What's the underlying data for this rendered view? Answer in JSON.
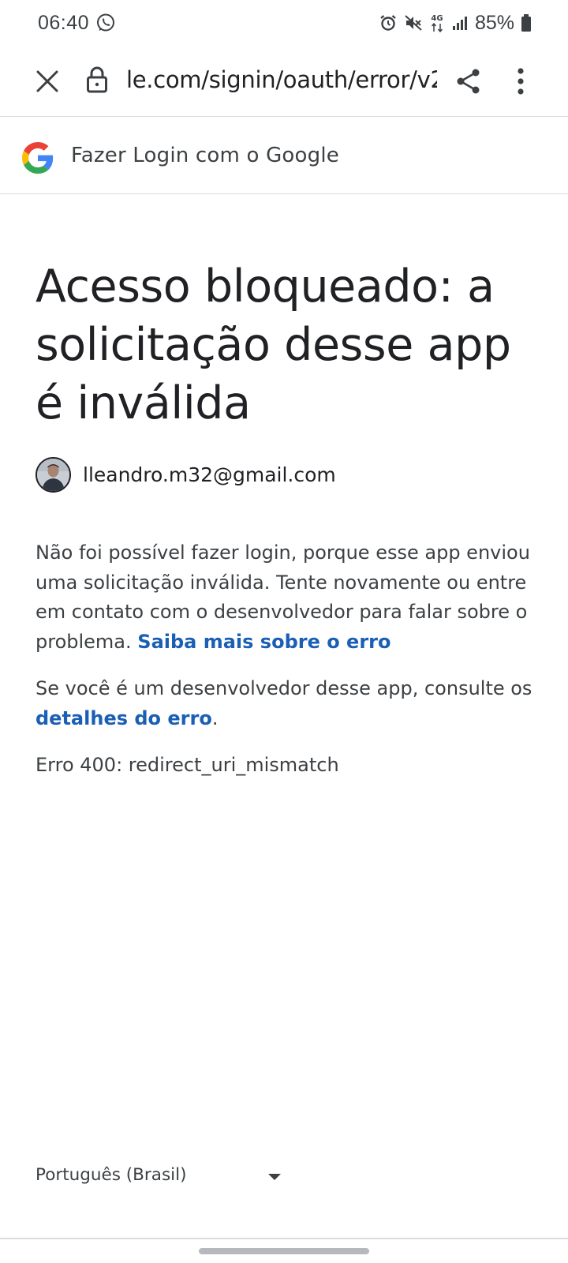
{
  "status_bar": {
    "time": "06:40",
    "battery": "85%",
    "network": "4G",
    "icons": [
      "whatsapp-icon",
      "alarm-icon",
      "mute-icon",
      "4g-icon",
      "signal-icon",
      "battery-icon"
    ]
  },
  "browser": {
    "url": "le.com/signin/oauth/error/v2",
    "icons": [
      "close-icon",
      "lock-icon",
      "share-icon",
      "more-vert-icon"
    ]
  },
  "signin_header": {
    "title": "Fazer Login com o Google",
    "logo": "google-g-logo"
  },
  "main": {
    "title": "Acesso bloqueado: a solicitação desse app é inválida",
    "account_email": "lleandro.m32@gmail.com",
    "paragraph1_text": "Não foi possível fazer login, porque esse app enviou uma solicitação inválida. Tente novamente ou entre em contato com o desenvolvedor para falar sobre o problema. ",
    "paragraph1_link": "Saiba mais sobre o erro",
    "paragraph2_text": "Se você é um desenvolvedor desse app, consulte os ",
    "paragraph2_link": "detalhes do erro",
    "paragraph2_end": ".",
    "error_code": "Erro 400: redirect_uri_mismatch"
  },
  "footer": {
    "language": "Português (Brasil)"
  },
  "colors": {
    "link": "#1a5fb4",
    "text": "#202124",
    "secondary_text": "#3c4043",
    "divider": "#dadce0",
    "google_blue": "#4285F4",
    "google_red": "#EA4335",
    "google_yellow": "#FBBC05",
    "google_green": "#34A853"
  }
}
